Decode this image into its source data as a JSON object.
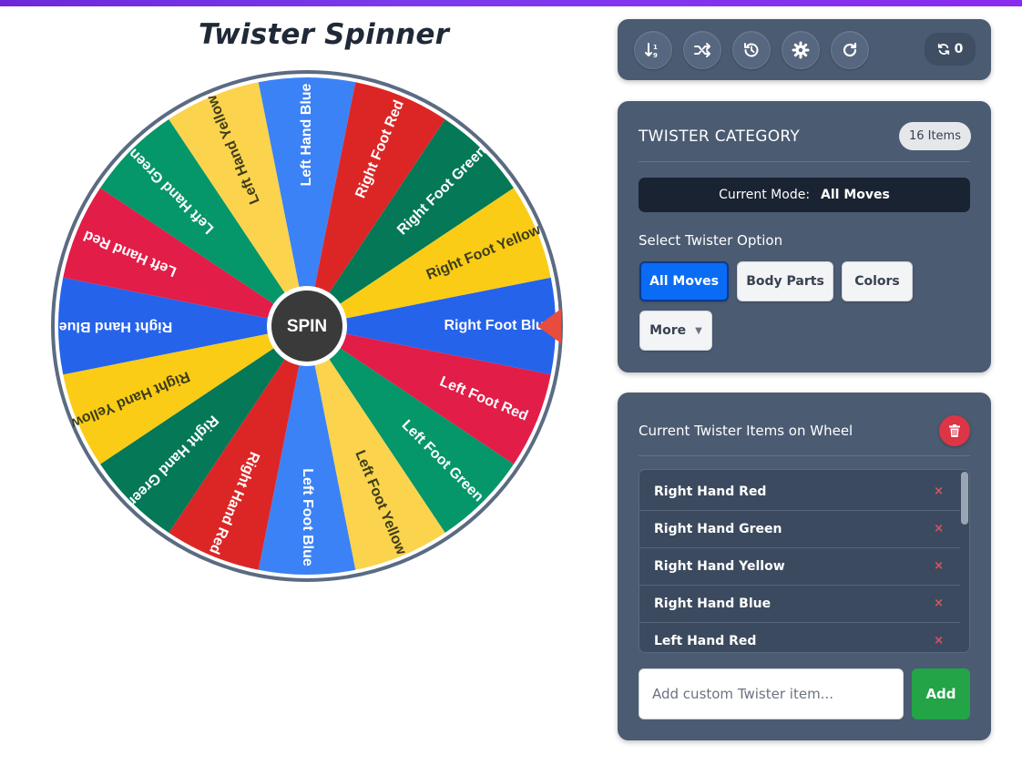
{
  "title": "Twister Spinner",
  "wheel": {
    "center_label": "SPIN",
    "segments": [
      {
        "label": "Right Foot Blue",
        "color": "#2563eb"
      },
      {
        "label": "Left Foot Red",
        "color": "#e11d48"
      },
      {
        "label": "Left Foot Green",
        "color": "#059669"
      },
      {
        "label": "Left Foot Yellow",
        "color": "#fcd34d"
      },
      {
        "label": "Left Foot Blue",
        "color": "#3b82f6"
      },
      {
        "label": "Right Hand Red",
        "color": "#dc2626"
      },
      {
        "label": "Right Hand Green",
        "color": "#047857"
      },
      {
        "label": "Right Hand Yellow",
        "color": "#facc15"
      },
      {
        "label": "Right Hand Blue",
        "color": "#2563eb"
      },
      {
        "label": "Left Hand Red",
        "color": "#e11d48"
      },
      {
        "label": "Left Hand Green",
        "color": "#059669"
      },
      {
        "label": "Left Hand Yellow",
        "color": "#fcd34d"
      },
      {
        "label": "Left Hand Blue",
        "color": "#3b82f6"
      },
      {
        "label": "Right Foot Red",
        "color": "#dc2626"
      },
      {
        "label": "Right Foot Green",
        "color": "#047857"
      },
      {
        "label": "Right Foot Yellow",
        "color": "#facc15"
      }
    ],
    "pointer_color": "#e74c3c"
  },
  "toolbar": {
    "buttons": [
      {
        "name": "sort-icon"
      },
      {
        "name": "shuffle-icon"
      },
      {
        "name": "history-icon"
      },
      {
        "name": "gear-icon"
      },
      {
        "name": "reset-icon"
      }
    ],
    "spin_count": "0"
  },
  "category": {
    "title": "TWISTER CATEGORY",
    "items_badge": "16 Items",
    "mode_label": "Current Mode:",
    "mode_value": "All Moves",
    "option_label": "Select Twister Option",
    "options": [
      "All Moves",
      "Body Parts",
      "Colors",
      "More"
    ],
    "active_option": "All Moves"
  },
  "items": {
    "title": "Current Twister Items on Wheel",
    "list": [
      "Right Hand Red",
      "Right Hand Green",
      "Right Hand Yellow",
      "Right Hand Blue",
      "Left Hand Red"
    ],
    "remove_symbol": "×",
    "input_placeholder": "Add custom Twister item...",
    "add_label": "Add"
  }
}
